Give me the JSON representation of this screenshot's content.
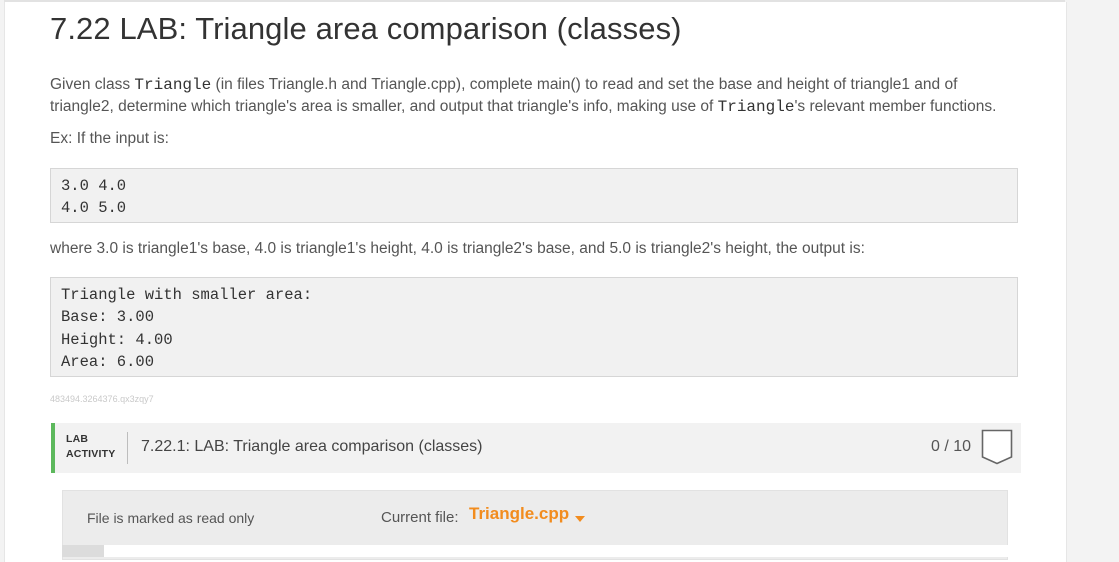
{
  "lesson": {
    "title": "7.22 LAB: Triangle area comparison (classes)",
    "intro_1": "Given class ",
    "class_name": "Triangle",
    "intro_2": " (in files Triangle.h and Triangle.cpp), complete main() to read and set the base and height of triangle1 and of",
    "intro_3": "triangle2, determine which triangle's area is smaller, and output that triangle's info, making use of ",
    "class_name_2": "Triangle",
    "intro_4": "'s relevant member functions.",
    "example_intro": "Ex: If the input is:",
    "input_lines": [
      "3.0 4.0",
      "4.0 5.0"
    ],
    "where_text": "where 3.0 is triangle1's base, 4.0 is triangle1's height, 4.0 is triangle2's base, and 5.0 is triangle2's height, the output is:",
    "output_lines": [
      "Triangle with smaller area:",
      "Base: 3.00",
      "Height: 4.00",
      "Area: 6.00"
    ],
    "hash_id": "483494.3264376.qx3zqy7"
  },
  "lab": {
    "label_line1": "LAB",
    "label_line2": "ACTIVITY",
    "activity_title": "7.22.1: LAB: Triangle area comparison (classes)",
    "score": "0 / 10",
    "accent_color": "#5cb85c"
  },
  "editor": {
    "readonly_text": "File is marked as read only",
    "current_file_label": "Current file:",
    "current_file": "Triangle.cpp",
    "accent_color": "#f28c1e"
  }
}
